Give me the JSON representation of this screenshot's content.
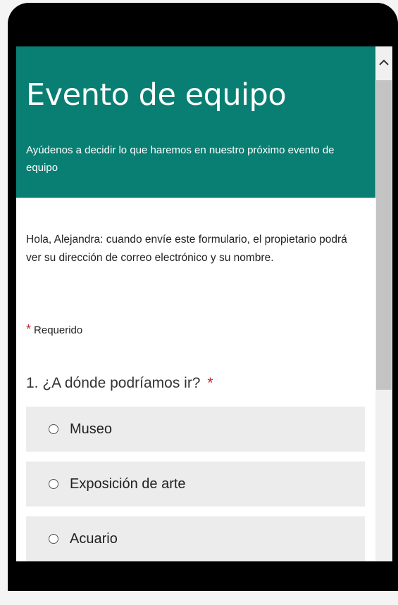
{
  "form": {
    "title": "Evento de equipo",
    "subtitle": "Ayúdenos a decidir lo que haremos en nuestro próximo evento de equipo",
    "notice": "Hola, Alejandra: cuando envíe este formulario, el propietario podrá ver su dirección de correo electrónico y su nombre.",
    "required_star": "*",
    "required_label": "Requerido",
    "question": {
      "number": "1.",
      "text": "¿A dónde podríamos ir?",
      "required_star": "*",
      "options": [
        "Museo",
        "Exposición de arte",
        "Acuario"
      ]
    }
  },
  "colors": {
    "header_bg": "#097f73",
    "required_star": "#c4262e"
  },
  "icons": {
    "scroll_up": "chevron-up-icon",
    "radio": "radio-button-icon"
  }
}
